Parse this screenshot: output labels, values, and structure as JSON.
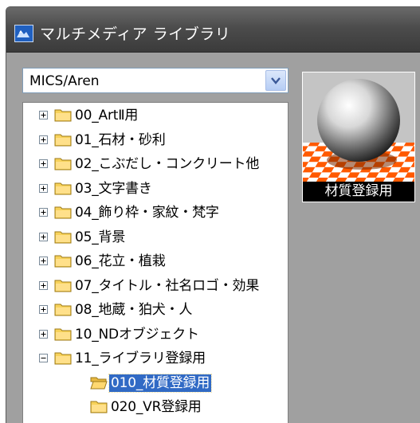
{
  "window": {
    "title": "マルチメディア ライブラリ",
    "icon": "library-app-icon"
  },
  "library_selector": {
    "value": "MICS/Aren",
    "icon": "chevron-down-icon"
  },
  "tree": {
    "items": [
      {
        "label": "00_ArtⅡ用",
        "expanded": false
      },
      {
        "label": "01_石材・砂利",
        "expanded": false
      },
      {
        "label": "02_こぶだし・コンクリート他",
        "expanded": false
      },
      {
        "label": "03_文字書き",
        "expanded": false
      },
      {
        "label": "04_飾り枠・家紋・梵字",
        "expanded": false
      },
      {
        "label": "05_背景",
        "expanded": false
      },
      {
        "label": "06_花立・植栽",
        "expanded": false
      },
      {
        "label": "07_タイトル・社名ロゴ・効果",
        "expanded": false
      },
      {
        "label": "08_地蔵・狛犬・人",
        "expanded": false
      },
      {
        "label": "10_NDオブジェクト",
        "expanded": false
      },
      {
        "label": "11_ライブラリ登録用",
        "expanded": true
      }
    ],
    "children": [
      {
        "label": "010_材質登録用",
        "selected": true
      },
      {
        "label": "020_VR登録用",
        "selected": false
      }
    ]
  },
  "preview": {
    "caption": "材質登録用",
    "icon": "material-sphere-icon"
  },
  "colors": {
    "selection": "#316ac5",
    "panel": "#a0a0a0",
    "titlebar": "#4c4c4c",
    "checker_orange": "#ff5a00"
  }
}
